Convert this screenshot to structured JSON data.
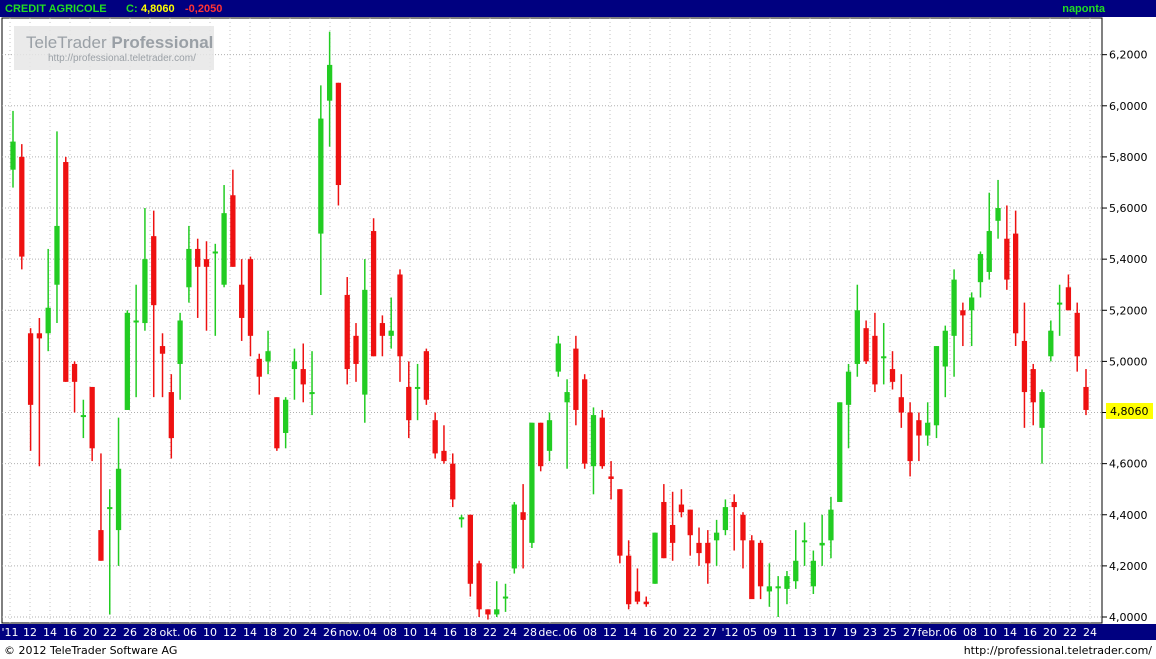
{
  "header": {
    "ticker_label": "CREDIT AGRICOLE",
    "close_label": "C:",
    "close_value": "4,8060",
    "change_value": "-0,2050",
    "timeframe": "naponta"
  },
  "watermark": {
    "brand_normal": "TeleTrader",
    "brand_bold": "Professional",
    "url": "http://professional.teletrader.com/"
  },
  "footer": {
    "copyright": "© 2012 TeleTrader Software AG",
    "url": "http://professional.teletrader.com/"
  },
  "colors": {
    "up": "#22cc22",
    "down": "#ee1111",
    "header_bg": "#000080",
    "ticker_text": "#22dd22",
    "close_text": "#ffff00",
    "axis_bg": "#000080",
    "current_price_bg": "#ffff00"
  },
  "chart_data": {
    "type": "candlestick",
    "y_ticks": [
      "6,2000",
      "6,0000",
      "5,8000",
      "5,6000",
      "5,4000",
      "5,2000",
      "5,0000",
      "4,8000",
      "4,6000",
      "4,4000",
      "4,2000",
      "4,0000"
    ],
    "current_price_label": "4,8060",
    "ylim": [
      3.995,
      6.42
    ],
    "x_labels": [
      "'11",
      "12",
      "14",
      "16",
      "20",
      "22",
      "26",
      "28",
      "okt.",
      "06",
      "10",
      "12",
      "14",
      "18",
      "20",
      "24",
      "26",
      "nov.",
      "04",
      "08",
      "10",
      "14",
      "16",
      "18",
      "22",
      "24",
      "28",
      "dec.",
      "06",
      "08",
      "12",
      "14",
      "16",
      "20",
      "22",
      "27",
      "'12",
      "05",
      "09",
      "11",
      "13",
      "17",
      "19",
      "23",
      "25",
      "27",
      "febr.",
      "06",
      "08",
      "10",
      "14",
      "16",
      "20",
      "22",
      "24"
    ],
    "grid": true,
    "candles": [
      {
        "o": 5.75,
        "h": 5.98,
        "l": 5.68,
        "c": 5.86
      },
      {
        "o": 5.8,
        "h": 5.85,
        "l": 5.36,
        "c": 5.41
      },
      {
        "o": 5.11,
        "h": 5.13,
        "l": 4.65,
        "c": 4.83
      },
      {
        "o": 5.11,
        "h": 5.17,
        "l": 4.59,
        "c": 5.09
      },
      {
        "o": 5.11,
        "h": 5.44,
        "l": 5.04,
        "c": 5.21
      },
      {
        "o": 5.3,
        "h": 5.9,
        "l": 5.15,
        "c": 5.53
      },
      {
        "o": 5.78,
        "h": 5.8,
        "l": 4.92,
        "c": 4.92
      },
      {
        "o": 4.99,
        "h": 5.0,
        "l": 4.8,
        "c": 4.92
      },
      {
        "o": 4.79,
        "h": 4.85,
        "l": 4.7,
        "c": 4.79
      },
      {
        "o": 4.9,
        "h": 4.9,
        "l": 4.61,
        "c": 4.66
      },
      {
        "o": 4.34,
        "h": 4.64,
        "l": 4.22,
        "c": 4.22
      },
      {
        "o": 4.43,
        "h": 4.5,
        "l": 4.01,
        "c": 4.43
      },
      {
        "o": 4.34,
        "h": 4.78,
        "l": 4.2,
        "c": 4.58
      },
      {
        "o": 4.81,
        "h": 5.2,
        "l": 4.81,
        "c": 5.19
      },
      {
        "o": 5.16,
        "h": 5.3,
        "l": 4.86,
        "c": 5.16
      },
      {
        "o": 5.15,
        "h": 5.6,
        "l": 5.12,
        "c": 5.4
      },
      {
        "o": 5.49,
        "h": 5.59,
        "l": 4.86,
        "c": 5.22
      },
      {
        "o": 5.06,
        "h": 5.11,
        "l": 4.86,
        "c": 5.03
      },
      {
        "o": 4.88,
        "h": 4.95,
        "l": 4.62,
        "c": 4.7
      },
      {
        "o": 4.99,
        "h": 5.19,
        "l": 4.85,
        "c": 5.16
      },
      {
        "o": 5.29,
        "h": 5.53,
        "l": 5.23,
        "c": 5.44
      },
      {
        "o": 5.44,
        "h": 5.48,
        "l": 5.17,
        "c": 5.37
      },
      {
        "o": 5.4,
        "h": 5.47,
        "l": 5.12,
        "c": 5.37
      },
      {
        "o": 5.43,
        "h": 5.46,
        "l": 5.1,
        "c": 5.43
      },
      {
        "o": 5.3,
        "h": 5.69,
        "l": 5.29,
        "c": 5.58
      },
      {
        "o": 5.65,
        "h": 5.75,
        "l": 5.37,
        "c": 5.37
      },
      {
        "o": 5.3,
        "h": 5.4,
        "l": 5.08,
        "c": 5.17
      },
      {
        "o": 5.4,
        "h": 5.41,
        "l": 5.02,
        "c": 5.1
      },
      {
        "o": 5.01,
        "h": 5.03,
        "l": 4.87,
        "c": 4.94
      },
      {
        "o": 5.0,
        "h": 5.12,
        "l": 4.95,
        "c": 5.04
      },
      {
        "o": 4.86,
        "h": 4.86,
        "l": 4.65,
        "c": 4.66
      },
      {
        "o": 4.72,
        "h": 4.86,
        "l": 4.66,
        "c": 4.85
      },
      {
        "o": 4.97,
        "h": 5.05,
        "l": 4.85,
        "c": 5.0
      },
      {
        "o": 4.97,
        "h": 5.07,
        "l": 4.84,
        "c": 4.91
      },
      {
        "o": 4.88,
        "h": 5.04,
        "l": 4.79,
        "c": 4.88
      },
      {
        "o": 5.5,
        "h": 6.08,
        "l": 5.26,
        "c": 5.95
      },
      {
        "o": 6.02,
        "h": 6.29,
        "l": 5.84,
        "c": 6.16
      },
      {
        "o": 6.09,
        "h": 6.09,
        "l": 5.61,
        "c": 5.69
      },
      {
        "o": 5.26,
        "h": 5.33,
        "l": 4.91,
        "c": 4.97
      },
      {
        "o": 5.1,
        "h": 5.15,
        "l": 4.92,
        "c": 4.99
      },
      {
        "o": 4.87,
        "h": 5.4,
        "l": 4.76,
        "c": 5.28
      },
      {
        "o": 5.51,
        "h": 5.56,
        "l": 5.02,
        "c": 5.02
      },
      {
        "o": 5.15,
        "h": 5.18,
        "l": 5.02,
        "c": 5.1
      },
      {
        "o": 5.1,
        "h": 5.25,
        "l": 5.05,
        "c": 5.12
      },
      {
        "o": 5.34,
        "h": 5.36,
        "l": 4.92,
        "c": 5.02
      },
      {
        "o": 4.9,
        "h": 5.0,
        "l": 4.7,
        "c": 4.77
      },
      {
        "o": 4.9,
        "h": 4.99,
        "l": 4.77,
        "c": 4.9
      },
      {
        "o": 5.04,
        "h": 5.05,
        "l": 4.83,
        "c": 4.85
      },
      {
        "o": 4.77,
        "h": 4.8,
        "l": 4.62,
        "c": 4.64
      },
      {
        "o": 4.65,
        "h": 4.75,
        "l": 4.6,
        "c": 4.61
      },
      {
        "o": 4.6,
        "h": 4.64,
        "l": 4.43,
        "c": 4.46
      },
      {
        "o": 4.39,
        "h": 4.4,
        "l": 4.35,
        "c": 4.39
      },
      {
        "o": 4.4,
        "h": 4.4,
        "l": 4.08,
        "c": 4.13
      },
      {
        "o": 4.21,
        "h": 4.22,
        "l": 4.0,
        "c": 4.03
      },
      {
        "o": 4.03,
        "h": 4.03,
        "l": 3.99,
        "c": 4.01
      },
      {
        "o": 4.01,
        "h": 4.14,
        "l": 4.0,
        "c": 4.03
      },
      {
        "o": 4.08,
        "h": 4.13,
        "l": 4.02,
        "c": 4.08
      },
      {
        "o": 4.19,
        "h": 4.45,
        "l": 4.17,
        "c": 4.44
      },
      {
        "o": 4.41,
        "h": 4.52,
        "l": 4.19,
        "c": 4.38
      },
      {
        "o": 4.29,
        "h": 4.76,
        "l": 4.27,
        "c": 4.76
      },
      {
        "o": 4.76,
        "h": 4.76,
        "l": 4.57,
        "c": 4.59
      },
      {
        "o": 4.65,
        "h": 4.8,
        "l": 4.61,
        "c": 4.77
      },
      {
        "o": 4.96,
        "h": 5.1,
        "l": 4.94,
        "c": 5.07
      },
      {
        "o": 4.84,
        "h": 4.93,
        "l": 4.58,
        "c": 4.88
      },
      {
        "o": 5.05,
        "h": 5.1,
        "l": 4.75,
        "c": 4.81
      },
      {
        "o": 4.93,
        "h": 4.95,
        "l": 4.58,
        "c": 4.6
      },
      {
        "o": 4.59,
        "h": 4.82,
        "l": 4.48,
        "c": 4.79
      },
      {
        "o": 4.78,
        "h": 4.81,
        "l": 4.58,
        "c": 4.59
      },
      {
        "o": 4.55,
        "h": 4.61,
        "l": 4.46,
        "c": 4.54
      },
      {
        "o": 4.5,
        "h": 4.5,
        "l": 4.21,
        "c": 4.24
      },
      {
        "o": 4.24,
        "h": 4.3,
        "l": 4.03,
        "c": 4.05
      },
      {
        "o": 4.1,
        "h": 4.19,
        "l": 4.05,
        "c": 4.06
      },
      {
        "o": 4.06,
        "h": 4.08,
        "l": 4.04,
        "c": 4.05
      },
      {
        "o": 4.13,
        "h": 4.33,
        "l": 4.13,
        "c": 4.33
      },
      {
        "o": 4.45,
        "h": 4.52,
        "l": 4.23,
        "c": 4.23
      },
      {
        "o": 4.36,
        "h": 4.49,
        "l": 4.22,
        "c": 4.29
      },
      {
        "o": 4.44,
        "h": 4.5,
        "l": 4.39,
        "c": 4.41
      },
      {
        "o": 4.42,
        "h": 4.42,
        "l": 4.24,
        "c": 4.32
      },
      {
        "o": 4.29,
        "h": 4.35,
        "l": 4.2,
        "c": 4.25
      },
      {
        "o": 4.29,
        "h": 4.34,
        "l": 4.13,
        "c": 4.21
      },
      {
        "o": 4.3,
        "h": 4.38,
        "l": 4.2,
        "c": 4.33
      },
      {
        "o": 4.34,
        "h": 4.46,
        "l": 4.32,
        "c": 4.43
      },
      {
        "o": 4.45,
        "h": 4.48,
        "l": 4.26,
        "c": 4.43
      },
      {
        "o": 4.4,
        "h": 4.41,
        "l": 4.19,
        "c": 4.3
      },
      {
        "o": 4.3,
        "h": 4.32,
        "l": 4.08,
        "c": 4.07
      },
      {
        "o": 4.29,
        "h": 4.3,
        "l": 4.07,
        "c": 4.12
      },
      {
        "o": 4.1,
        "h": 4.21,
        "l": 4.04,
        "c": 4.12
      },
      {
        "o": 4.12,
        "h": 4.16,
        "l": 4.0,
        "c": 4.12
      },
      {
        "o": 4.11,
        "h": 4.18,
        "l": 4.05,
        "c": 4.16
      },
      {
        "o": 4.14,
        "h": 4.34,
        "l": 4.11,
        "c": 4.22
      },
      {
        "o": 4.3,
        "h": 4.37,
        "l": 4.2,
        "c": 4.3
      },
      {
        "o": 4.12,
        "h": 4.26,
        "l": 4.09,
        "c": 4.22
      },
      {
        "o": 4.28,
        "h": 4.4,
        "l": 4.2,
        "c": 4.29
      },
      {
        "o": 4.3,
        "h": 4.47,
        "l": 4.23,
        "c": 4.42
      },
      {
        "o": 4.45,
        "h": 4.84,
        "l": 4.45,
        "c": 4.84
      },
      {
        "o": 4.83,
        "h": 4.99,
        "l": 4.66,
        "c": 4.96
      },
      {
        "o": 4.99,
        "h": 5.3,
        "l": 4.94,
        "c": 5.2
      },
      {
        "o": 5.13,
        "h": 5.16,
        "l": 4.99,
        "c": 5.0
      },
      {
        "o": 5.1,
        "h": 5.19,
        "l": 4.88,
        "c": 4.91
      },
      {
        "o": 5.02,
        "h": 5.15,
        "l": 4.91,
        "c": 5.02
      },
      {
        "o": 4.97,
        "h": 5.04,
        "l": 4.89,
        "c": 4.92
      },
      {
        "o": 4.86,
        "h": 4.95,
        "l": 4.74,
        "c": 4.8
      },
      {
        "o": 4.8,
        "h": 4.84,
        "l": 4.55,
        "c": 4.61
      },
      {
        "o": 4.77,
        "h": 4.8,
        "l": 4.61,
        "c": 4.71
      },
      {
        "o": 4.71,
        "h": 4.84,
        "l": 4.67,
        "c": 4.76
      },
      {
        "o": 4.75,
        "h": 5.06,
        "l": 4.7,
        "c": 5.06
      },
      {
        "o": 4.98,
        "h": 5.14,
        "l": 4.86,
        "c": 5.12
      },
      {
        "o": 5.1,
        "h": 5.36,
        "l": 4.94,
        "c": 5.32
      },
      {
        "o": 5.2,
        "h": 5.23,
        "l": 5.06,
        "c": 5.18
      },
      {
        "o": 5.2,
        "h": 5.27,
        "l": 5.06,
        "c": 5.25
      },
      {
        "o": 5.31,
        "h": 5.43,
        "l": 5.25,
        "c": 5.42
      },
      {
        "o": 5.35,
        "h": 5.66,
        "l": 5.32,
        "c": 5.51
      },
      {
        "o": 5.55,
        "h": 5.71,
        "l": 5.48,
        "c": 5.6
      },
      {
        "o": 5.48,
        "h": 5.61,
        "l": 5.28,
        "c": 5.32
      },
      {
        "o": 5.5,
        "h": 5.59,
        "l": 5.06,
        "c": 5.11
      },
      {
        "o": 5.08,
        "h": 5.23,
        "l": 4.74,
        "c": 4.88
      },
      {
        "o": 4.97,
        "h": 4.99,
        "l": 4.75,
        "c": 4.84
      },
      {
        "o": 4.74,
        "h": 4.89,
        "l": 4.6,
        "c": 4.88
      },
      {
        "o": 5.02,
        "h": 5.16,
        "l": 5.0,
        "c": 5.12
      },
      {
        "o": 5.23,
        "h": 5.3,
        "l": 5.1,
        "c": 5.23
      },
      {
        "o": 5.29,
        "h": 5.34,
        "l": 5.2,
        "c": 5.2
      },
      {
        "o": 5.19,
        "h": 5.23,
        "l": 4.96,
        "c": 5.02
      },
      {
        "o": 4.9,
        "h": 4.97,
        "l": 4.79,
        "c": 4.81
      }
    ]
  }
}
